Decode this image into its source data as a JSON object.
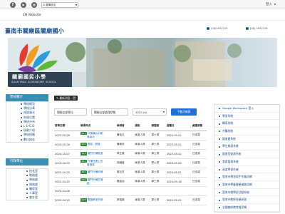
{
  "topbar": {
    "facebook_glyph": "f",
    "youtube_glyph": "▶",
    "email_glyph": "@",
    "translate_label": "選擇語言",
    "translate_g": "G",
    "login_label": "登入"
  },
  "nav": {
    "en_link": "EN Website"
  },
  "header": {
    "school_title": "臺南市關廟區關廟國小",
    "phone": "(06)5952220",
    "fax": "(06) 5952228"
  },
  "banner": {
    "name": "關廟國民小學",
    "subtitle": "GUAN MIAO ELEMENTARY SCHOOL"
  },
  "sidebar1": {
    "heading": "學校簡介",
    "items": [
      "學校概況",
      "學校沿革",
      "校園風光",
      "地理位置",
      "學校分布",
      "L O G O",
      "校歌介紹",
      "學校校徽",
      "數位校史"
    ]
  },
  "sidebar2": {
    "heading": "行政單位",
    "items": [
      "校長室",
      "教務處",
      "學務處",
      "總務處",
      "輔導室",
      "人事室",
      "會計室"
    ]
  },
  "announcements": {
    "tag_button": "最新消息一覽",
    "unit_filter": "關廟全部單位",
    "category_filter": "關廟全部處理狀態",
    "month_filter": "2025-04",
    "download_button": "下載月報表",
    "columns": [
      "發佈日期",
      "報導件名",
      "承辦者",
      "通知",
      "辦理者",
      "回覆日",
      "處理狀態"
    ],
    "rows": [
      {
        "date": "2025-04-28",
        "badge": "113",
        "title": "升旗陳台示範",
        "sub": "綠溪大",
        "owner": "陳怡文",
        "notify": "綠溪人員",
        "handler": "郭士書",
        "reply": "2025-05-02",
        "status": "已送達"
      },
      {
        "date": "2025-05-26",
        "badge": "113",
        "title": "看板 - 實習",
        "sub": "",
        "owner": "陳瑜安",
        "notify": "綠溪人員",
        "handler": "郭士書",
        "reply": "2025-05-02",
        "status": "已送達"
      },
      {
        "date": "2024-10-07",
        "badge": "113",
        "title": "國門升鋪推進",
        "sub": "",
        "owner": "林正雄",
        "notify": "綠溪人員",
        "handler": "郭士書",
        "reply": "2025-05-02",
        "status": "已送達"
      },
      {
        "date": "2025-04-25",
        "badge": "111",
        "title": "升鋪任裡上的",
        "sub": "發展表",
        "owner": "孫國盛",
        "notify": "綠溪人員",
        "handler": "郭士書",
        "reply": "2025-05-02",
        "status": "已送達"
      },
      {
        "date": "2025-04-25",
        "badge": "112",
        "title": "國門升鋪修補",
        "sub": "",
        "owner": "楊玉芳",
        "notify": "綠溪人員",
        "handler": "郭士書",
        "reply": "2025-05-02",
        "status": "已送達"
      },
      {
        "date": "2025-04-25",
        "badge": "109",
        "title": "國門升鋪貨補",
        "sub": "給",
        "owner": "蕭紹治",
        "notify": "綠溪人員",
        "handler": "郭士書",
        "reply": "2024-09-18",
        "status": "已送達"
      },
      {
        "date": "2025-04-06",
        "badge": "",
        "title": "",
        "sub": "",
        "owner": "",
        "notify": "",
        "handler": "",
        "reply": "",
        "status": ""
      },
      {
        "date": "2025-04-25",
        "badge": "113",
        "title": "電腦教室的使",
        "sub": "",
        "owner": "張瑞樂",
        "notify": "綠溪人員",
        "handler": "郭士書",
        "reply": "2025-05-02",
        "status": "已送達"
      }
    ]
  },
  "right_links": [
    "Google Workspace 登入",
    "學習系統",
    "輔導系統",
    "共購系統",
    "圖書館系統",
    "學生報表系統",
    "圖書室查詢系統",
    "食育管理系統",
    "高度學習作業",
    "臺南市學習幫手作業訊網",
    "臺南市學童健康檢查訊網",
    "臺南市樂學部活動系統",
    "臺南市教師專業研習",
    "全國教師教育資訊網"
  ],
  "colors": {
    "title_blue": "#1a4e8a",
    "sidebar_head": "#3a8fb5",
    "download_blue": "#1f6fd6",
    "badge_green": "#2e8b3a"
  }
}
